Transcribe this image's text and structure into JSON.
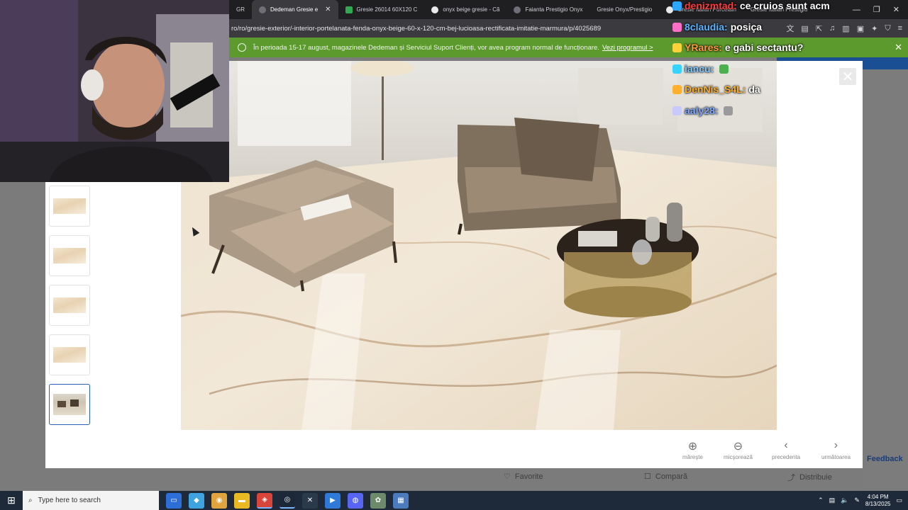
{
  "browser": {
    "tabs": [
      {
        "label": "GR",
        "active": false
      },
      {
        "label": "Dedeman Gresie e",
        "active": true
      },
      {
        "label": "Gresie 26014 60X120 C",
        "active": false
      },
      {
        "label": "onyx beige gresie - Cã",
        "active": false
      },
      {
        "label": "Faianta Prestigio Onyx",
        "active": false
      },
      {
        "label": "Gresie Onyx/Prestigio",
        "active": false
      },
      {
        "label": "Gresie Italian Porcelain",
        "active": false
      },
      {
        "label": "Gresie Italian Prestigio",
        "active": false
      }
    ],
    "url": "ro/ro/gresie-exterior/-interior-portelanata-fenda-onyx-beige-60-x-120-cm-bej-lucioasa-rectificata-imitatie-marmura/p/4025689"
  },
  "notice": {
    "text": "În perioada 15-17 august, magazinele Dedeman și Serviciul Suport Clienți, vor avea program normal de funcționare.",
    "link": "Vezi programul >"
  },
  "chat": [
    {
      "user": "denizmtad:",
      "msg": "ce cruios sunt acm",
      "color": "#ff3b3b"
    },
    {
      "user": "8claudia:",
      "msg": "posiça",
      "color": "#5ab4ff"
    },
    {
      "user": "YRares:",
      "msg": "e gabi sectantu?",
      "color": "#ff9a3c"
    },
    {
      "user": "iancu:",
      "msg": "",
      "color": "#7fc8ff"
    },
    {
      "user": "DenNis_S4L:",
      "msg": "da",
      "color": "#ffb02e"
    },
    {
      "user": "aaly28:",
      "msg": "",
      "color": "#7fa8ff"
    }
  ],
  "modal": {
    "controls": [
      {
        "label": "mărește",
        "icon": "zoom-in-icon",
        "glyph": "⊕"
      },
      {
        "label": "micșorează",
        "icon": "zoom-out-icon",
        "glyph": "⊖"
      },
      {
        "label": "precedenta",
        "icon": "chevron-left-icon",
        "glyph": "‹"
      },
      {
        "label": "următoarea",
        "icon": "chevron-right-icon",
        "glyph": "›"
      }
    ],
    "thumbnails": 5,
    "selected_thumbnail": 5
  },
  "page": {
    "favorite": "Favorite",
    "compare": "Compară",
    "share": "Distribuie",
    "feedback": "Feedback"
  },
  "taskbar": {
    "search_placeholder": "Type here to search",
    "time": "4:04 PM",
    "date": "8/13/2025"
  },
  "colors": {
    "notice_bg": "#5c9a2e",
    "accent": "#2a5fb5",
    "brand_blue": "#1a4f94"
  }
}
